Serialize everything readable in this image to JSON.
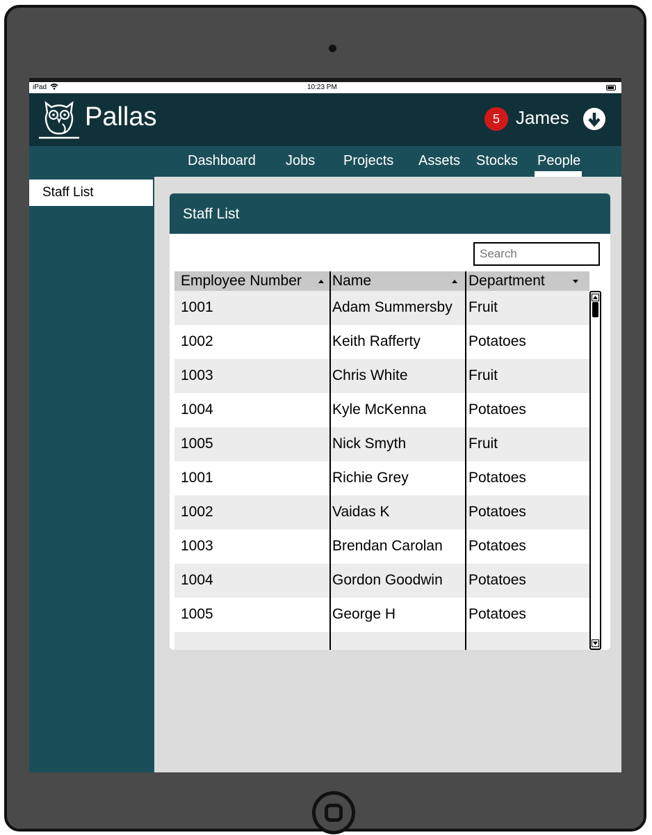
{
  "status_bar": {
    "device": "iPad",
    "time": "10:23 PM"
  },
  "header": {
    "app_name": "Pallas",
    "logo_icon": "owl-icon",
    "notification_count": "5",
    "user_name": "James",
    "user_menu_icon": "circle-arrow-down-icon"
  },
  "nav": {
    "items": [
      {
        "label": "Dashboard"
      },
      {
        "label": "Jobs"
      },
      {
        "label": "Projects"
      },
      {
        "label": "Assets"
      },
      {
        "label": "Stocks"
      },
      {
        "label": "People",
        "active": true
      }
    ]
  },
  "sidebar": {
    "items": [
      {
        "label": "Staff List",
        "active": true
      }
    ]
  },
  "panel": {
    "title": "Staff List",
    "search_placeholder": "Search"
  },
  "table": {
    "columns": [
      {
        "label": "Employee Number",
        "sort": "asc"
      },
      {
        "label": "Name",
        "sort": "asc"
      },
      {
        "label": "Department",
        "sort": "desc"
      }
    ],
    "rows": [
      [
        "1001",
        "Adam Summersby",
        "Fruit"
      ],
      [
        "1002",
        "Keith Rafferty",
        "Potatoes"
      ],
      [
        "1003",
        "Chris White",
        "Fruit"
      ],
      [
        "1004",
        "Kyle McKenna",
        "Potatoes"
      ],
      [
        "1005",
        "Nick Smyth",
        "Fruit"
      ],
      [
        "1001",
        "Richie Grey",
        "Potatoes"
      ],
      [
        "1002",
        "Vaidas K",
        "Potatoes"
      ],
      [
        "1003",
        "Brendan Carolan",
        "Potatoes"
      ],
      [
        "1004",
        "Gordon Goodwin",
        "Potatoes"
      ],
      [
        "1005",
        "George H",
        "Potatoes"
      ],
      [
        "",
        "",
        ""
      ]
    ]
  },
  "colors": {
    "header_bg": "#11313a",
    "nav_bg": "#1a4f5a",
    "badge": "#d21919",
    "content_bg": "#dcdcdc"
  }
}
